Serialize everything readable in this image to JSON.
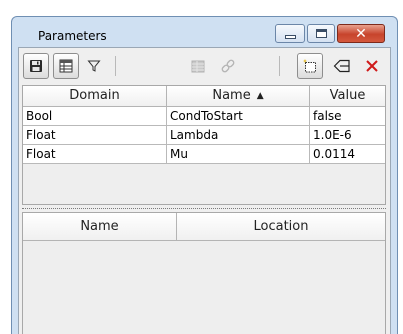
{
  "window": {
    "title": "Parameters",
    "close_glyph": "✕"
  },
  "toolbar": {
    "icons": [
      "save-icon",
      "table-view-icon",
      "filter-icon",
      "grid-icon",
      "link-icon",
      "new-item-icon",
      "insert-arrow-icon",
      "delete-icon"
    ]
  },
  "parameters_table": {
    "columns": [
      {
        "label": "Domain"
      },
      {
        "label": "Name",
        "sort": "▲"
      },
      {
        "label": "Value"
      }
    ],
    "rows": [
      {
        "domain": "Bool",
        "name": "CondToStart",
        "value": "false"
      },
      {
        "domain": "Float",
        "name": "Lambda",
        "value": "1.0E-6"
      },
      {
        "domain": "Float",
        "name": "Mu",
        "value": "0.0114"
      }
    ]
  },
  "locations_table": {
    "columns": [
      {
        "label": "Name"
      },
      {
        "label": "Location"
      }
    ]
  },
  "colors": {
    "title_bar": "#cfe0f2",
    "close_button": "#c7442c",
    "delete_icon": "#d01b1b"
  }
}
